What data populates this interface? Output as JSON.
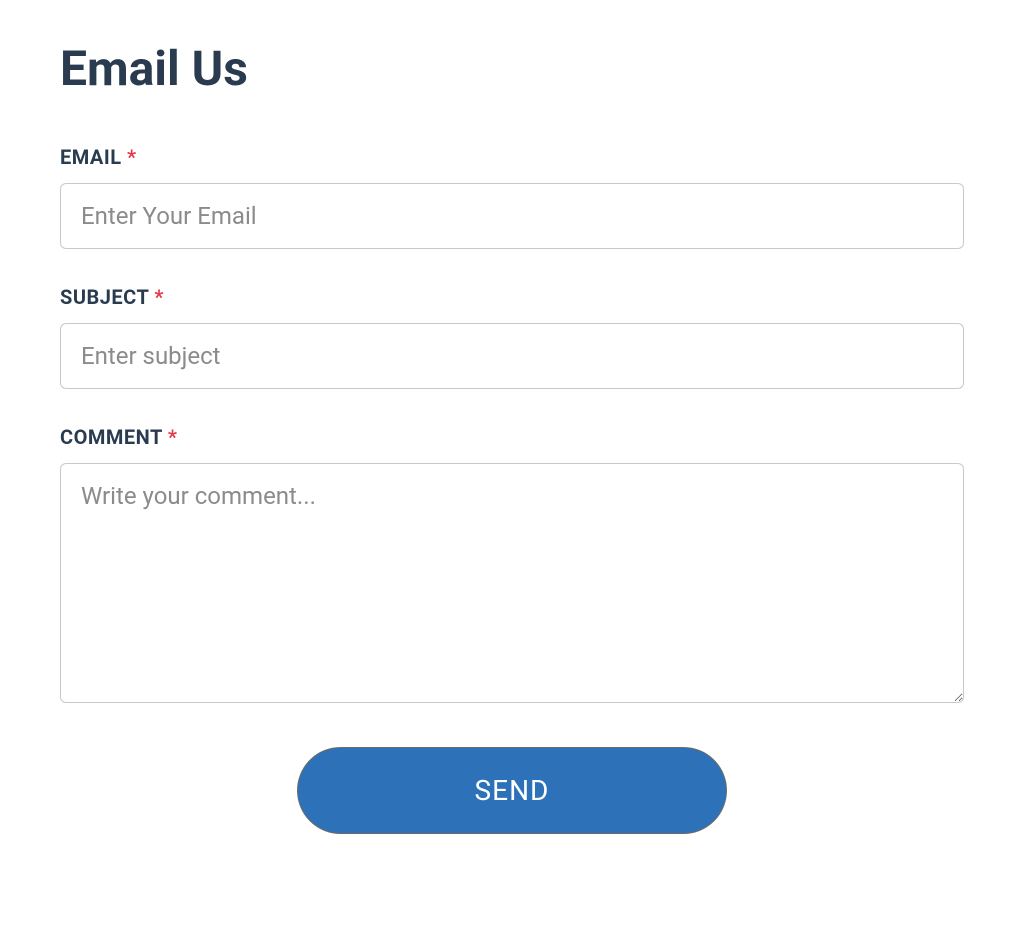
{
  "page": {
    "title": "Email Us"
  },
  "form": {
    "email": {
      "label": "EMAIL",
      "required_mark": "*",
      "placeholder": "Enter Your Email",
      "value": ""
    },
    "subject": {
      "label": "SUBJECT",
      "required_mark": "*",
      "placeholder": "Enter subject",
      "value": ""
    },
    "comment": {
      "label": "COMMENT",
      "required_mark": "*",
      "placeholder": "Write your comment...",
      "value": ""
    },
    "send_label": "SEND"
  }
}
